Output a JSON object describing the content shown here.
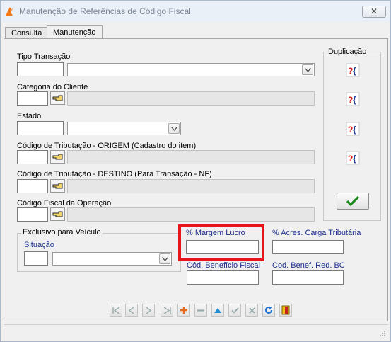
{
  "window": {
    "title": "Manutenção de Referências de Código Fiscal",
    "close_label": "✕"
  },
  "tabs": [
    {
      "label": "Consulta",
      "active": false
    },
    {
      "label": "Manutenção",
      "active": true
    }
  ],
  "form": {
    "tipo_transacao": {
      "label": "Tipo Transação",
      "code_value": "",
      "select_value": ""
    },
    "categoria_cliente": {
      "label": "Categoria do Cliente",
      "code_value": "",
      "description": ""
    },
    "estado": {
      "label": "Estado",
      "code_value": "",
      "select_value": ""
    },
    "trib_origem": {
      "label": "Código de Tributação - ORIGEM (Cadastro do item)",
      "code_value": "",
      "description": ""
    },
    "trib_destino": {
      "label": "Código de Tributação - DESTINO (Para Transação - NF)",
      "code_value": "",
      "description": ""
    },
    "cfop": {
      "label": "Código Fiscal da Operação",
      "code_value": "",
      "description": ""
    }
  },
  "exclusivo": {
    "legend": "Exclusivo para Veículo",
    "situacao_label": "Situação",
    "situacao_code": "",
    "situacao_select": ""
  },
  "fields": {
    "margem_lucro": {
      "label": "% Margem Lucro",
      "value": ""
    },
    "acres_carga": {
      "label": "% Acres. Carga Tributária",
      "value": ""
    },
    "cod_beneficio": {
      "label": "Cód. Benefício Fiscal",
      "value": ""
    },
    "cod_benef_red": {
      "label": "Cod. Benef. Red. BC",
      "value": ""
    }
  },
  "duplicacao": {
    "legend": "Duplicação",
    "button_glyph": "?{}"
  },
  "colors": {
    "highlight": "#e8141c",
    "label_blue": "#1a2e8c",
    "ok_green": "#1d8a1d"
  },
  "toolbar_icons": [
    "first-icon",
    "prev-icon",
    "next-icon",
    "last-icon",
    "insert-icon",
    "delete-icon",
    "edit-icon",
    "confirm-icon",
    "cancel-icon",
    "refresh-icon",
    "exit-icon"
  ]
}
